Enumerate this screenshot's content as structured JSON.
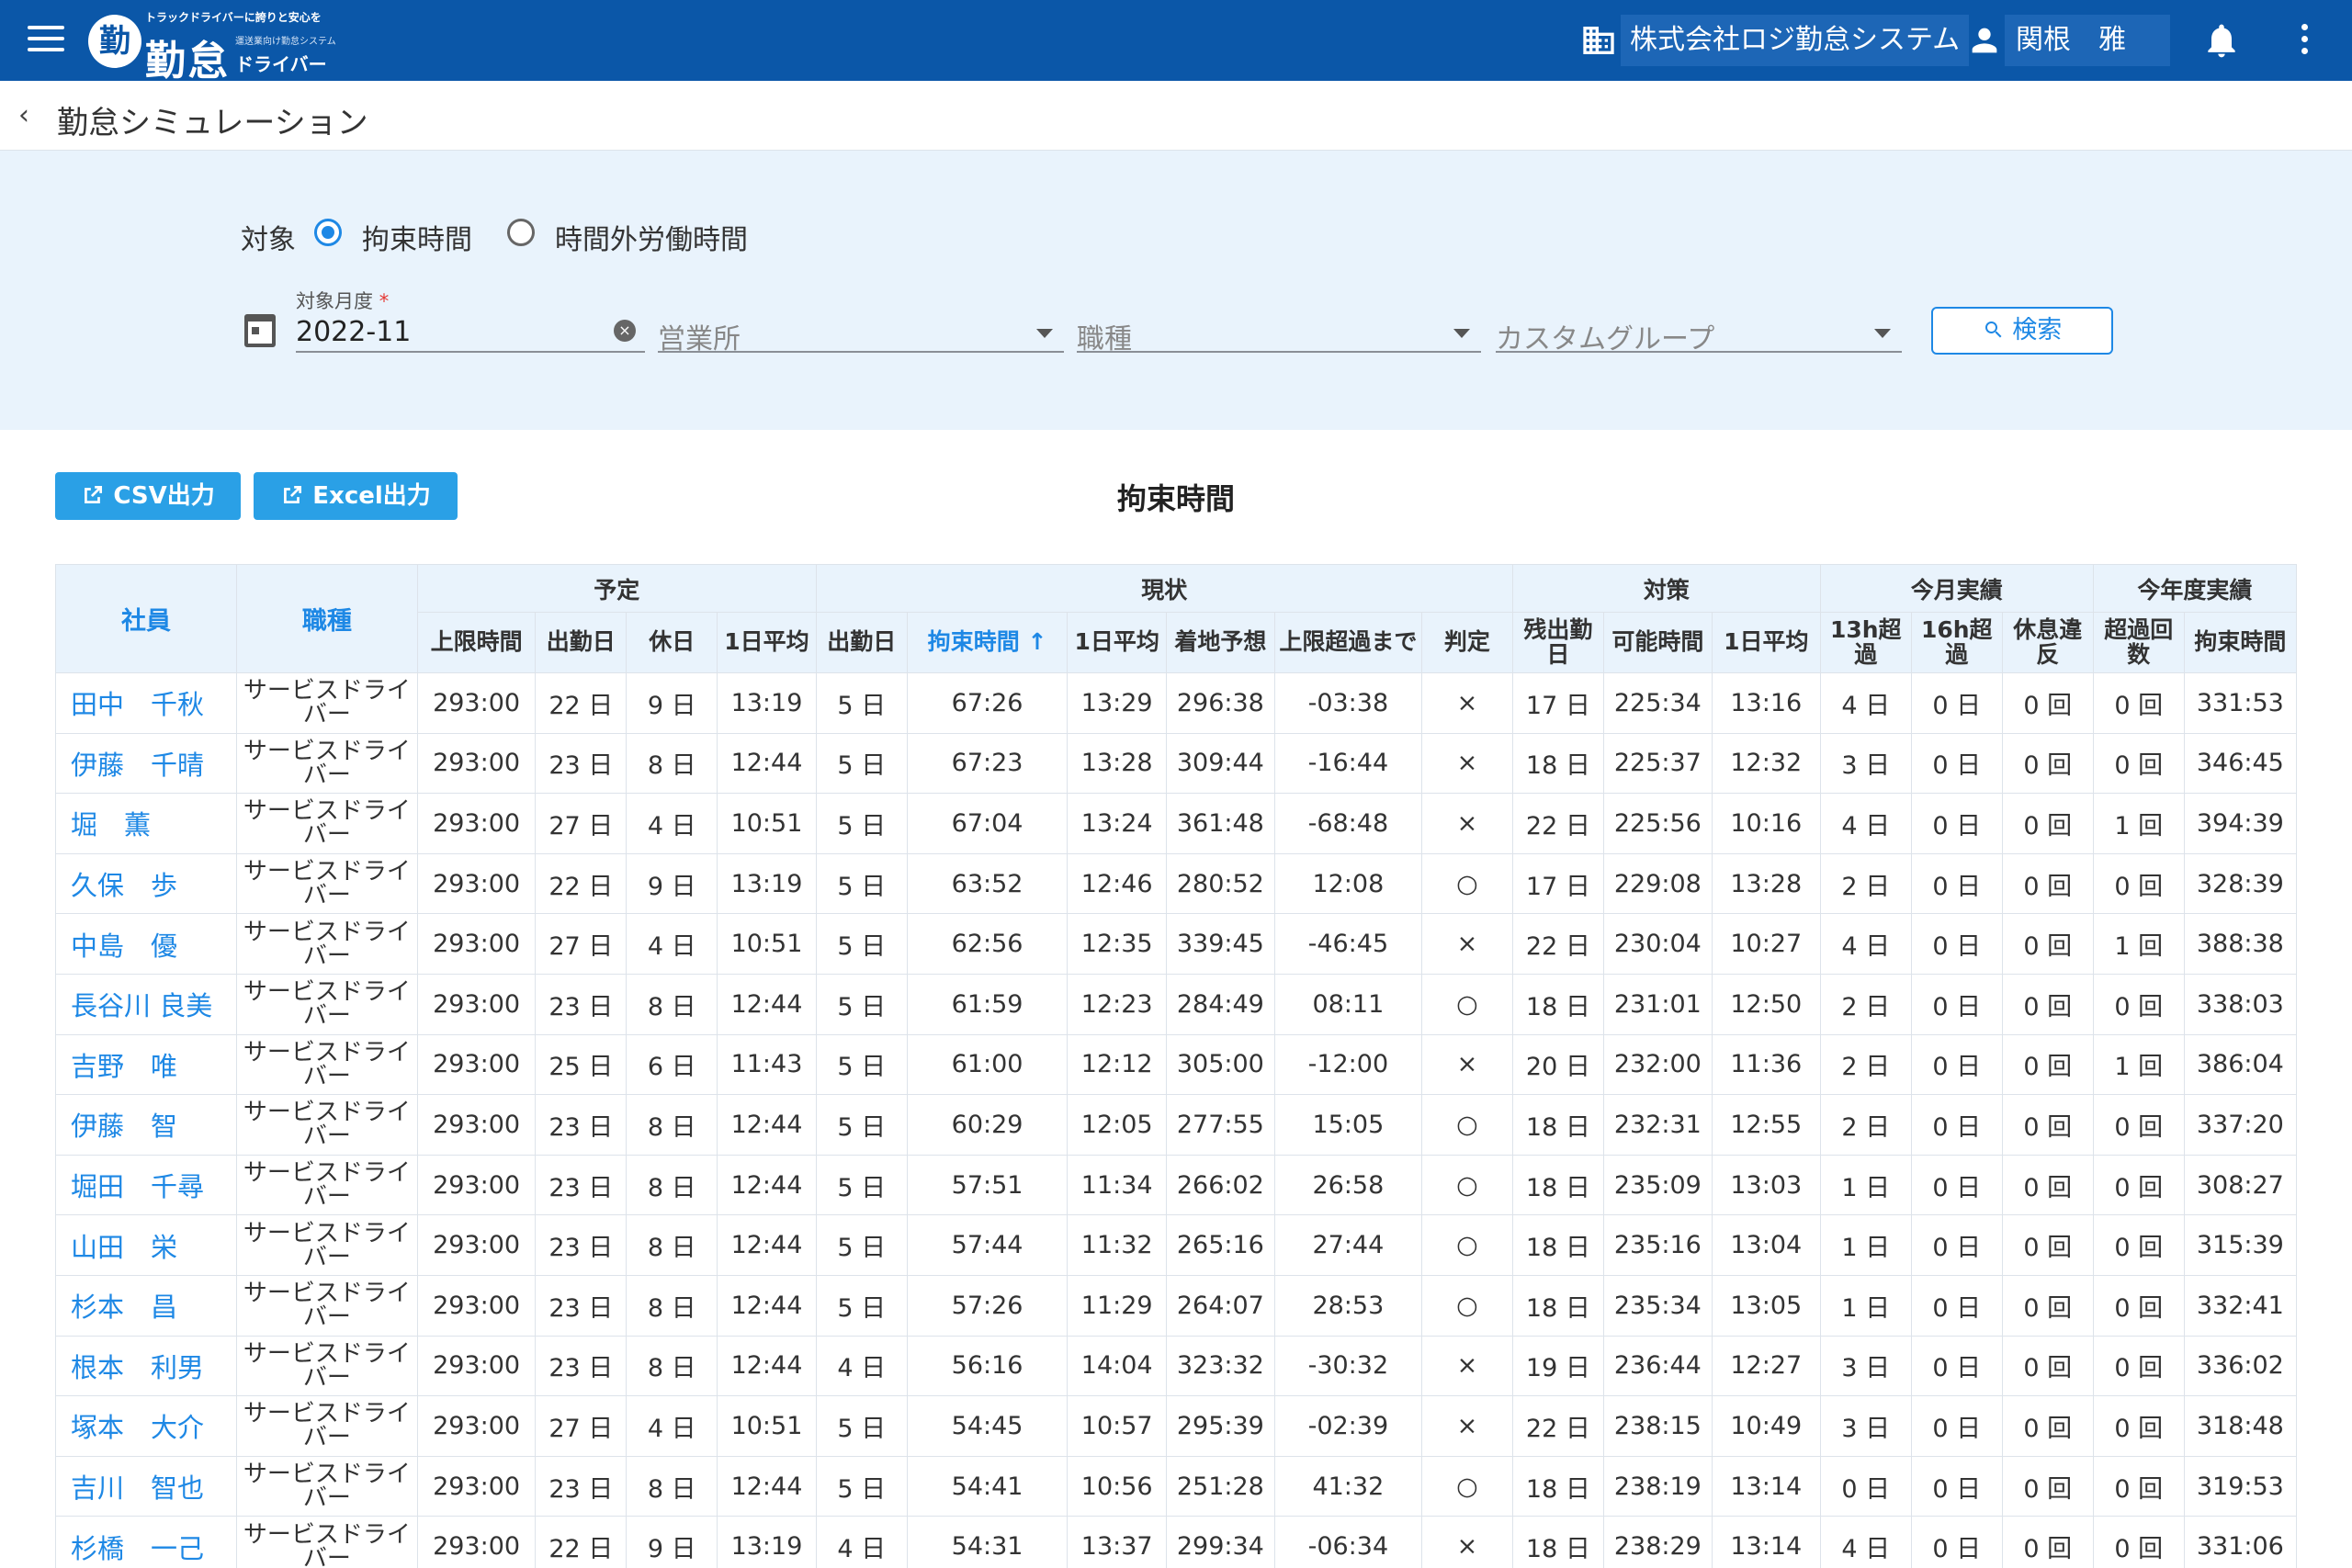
{
  "header": {
    "logo_tagline": "トラックドライバーに誇りと安心を",
    "logo_main": "勤怠",
    "logo_sub_small": "運送業向け勤怠システム",
    "logo_sub": "ドライバー",
    "company": "株式会社ロジ勤怠システム",
    "user": "関根　雅"
  },
  "page": {
    "title": "勤怠シミュレーション"
  },
  "filter": {
    "target_label": "対象",
    "radio_options": [
      "拘束時間",
      "時間外労働時間"
    ],
    "selected_radio": "拘束時間",
    "month_label": "対象月度",
    "month_required": "*",
    "month_value": "2022-11",
    "office_placeholder": "営業所",
    "job_placeholder": "職種",
    "group_placeholder": "カスタムグループ",
    "search_label": "検索"
  },
  "actions": {
    "csv_label": "CSV出力",
    "excel_label": "Excel出力"
  },
  "table": {
    "title": "拘束時間",
    "group_headers": [
      "予定",
      "現状",
      "対策",
      "今月実績",
      "今年度実績"
    ],
    "employee_header": "社員",
    "job_header": "職種",
    "sub_headers": [
      "上限時間",
      "出勤日",
      "休日",
      "1日平均",
      "出勤日",
      "拘束時間 ↑",
      "1日平均",
      "着地予想",
      "上限超過まで",
      "判定",
      "残出勤日",
      "可能時間",
      "1日平均",
      "13h超過",
      "16h超過",
      "休息違反",
      "超過回数",
      "拘束時間"
    ],
    "rows": [
      [
        "田中　千秋",
        "サービスドライバー",
        "293:00",
        "22 日",
        "9 日",
        "13:19",
        "5 日",
        "67:26",
        "13:29",
        "296:38",
        "-03:38",
        "×",
        "17 日",
        "225:34",
        "13:16",
        "4 日",
        "0 日",
        "0 回",
        "0 回",
        "331:53"
      ],
      [
        "伊藤　千晴",
        "サービスドライバー",
        "293:00",
        "23 日",
        "8 日",
        "12:44",
        "5 日",
        "67:23",
        "13:28",
        "309:44",
        "-16:44",
        "×",
        "18 日",
        "225:37",
        "12:32",
        "3 日",
        "0 日",
        "0 回",
        "0 回",
        "346:45"
      ],
      [
        "堀　薫",
        "サービスドライバー",
        "293:00",
        "27 日",
        "4 日",
        "10:51",
        "5 日",
        "67:04",
        "13:24",
        "361:48",
        "-68:48",
        "×",
        "22 日",
        "225:56",
        "10:16",
        "4 日",
        "0 日",
        "0 回",
        "1 回",
        "394:39"
      ],
      [
        "久保　歩",
        "サービスドライバー",
        "293:00",
        "22 日",
        "9 日",
        "13:19",
        "5 日",
        "63:52",
        "12:46",
        "280:52",
        "12:08",
        "○",
        "17 日",
        "229:08",
        "13:28",
        "2 日",
        "0 日",
        "0 回",
        "0 回",
        "328:39"
      ],
      [
        "中島　優",
        "サービスドライバー",
        "293:00",
        "27 日",
        "4 日",
        "10:51",
        "5 日",
        "62:56",
        "12:35",
        "339:45",
        "-46:45",
        "×",
        "22 日",
        "230:04",
        "10:27",
        "4 日",
        "0 日",
        "0 回",
        "1 回",
        "388:38"
      ],
      [
        "長谷川 良美",
        "サービスドライバー",
        "293:00",
        "23 日",
        "8 日",
        "12:44",
        "5 日",
        "61:59",
        "12:23",
        "284:49",
        "08:11",
        "○",
        "18 日",
        "231:01",
        "12:50",
        "2 日",
        "0 日",
        "0 回",
        "0 回",
        "338:03"
      ],
      [
        "吉野　唯",
        "サービスドライバー",
        "293:00",
        "25 日",
        "6 日",
        "11:43",
        "5 日",
        "61:00",
        "12:12",
        "305:00",
        "-12:00",
        "×",
        "20 日",
        "232:00",
        "11:36",
        "2 日",
        "0 日",
        "0 回",
        "1 回",
        "386:04"
      ],
      [
        "伊藤　智",
        "サービスドライバー",
        "293:00",
        "23 日",
        "8 日",
        "12:44",
        "5 日",
        "60:29",
        "12:05",
        "277:55",
        "15:05",
        "○",
        "18 日",
        "232:31",
        "12:55",
        "2 日",
        "0 日",
        "0 回",
        "0 回",
        "337:20"
      ],
      [
        "堀田　千尋",
        "サービスドライバー",
        "293:00",
        "23 日",
        "8 日",
        "12:44",
        "5 日",
        "57:51",
        "11:34",
        "266:02",
        "26:58",
        "○",
        "18 日",
        "235:09",
        "13:03",
        "1 日",
        "0 日",
        "0 回",
        "0 回",
        "308:27"
      ],
      [
        "山田　栄",
        "サービスドライバー",
        "293:00",
        "23 日",
        "8 日",
        "12:44",
        "5 日",
        "57:44",
        "11:32",
        "265:16",
        "27:44",
        "○",
        "18 日",
        "235:16",
        "13:04",
        "1 日",
        "0 日",
        "0 回",
        "0 回",
        "315:39"
      ],
      [
        "杉本　昌",
        "サービスドライバー",
        "293:00",
        "23 日",
        "8 日",
        "12:44",
        "5 日",
        "57:26",
        "11:29",
        "264:07",
        "28:53",
        "○",
        "18 日",
        "235:34",
        "13:05",
        "1 日",
        "0 日",
        "0 回",
        "0 回",
        "332:41"
      ],
      [
        "根本　利男",
        "サービスドライバー",
        "293:00",
        "23 日",
        "8 日",
        "12:44",
        "4 日",
        "56:16",
        "14:04",
        "323:32",
        "-30:32",
        "×",
        "19 日",
        "236:44",
        "12:27",
        "3 日",
        "0 日",
        "0 回",
        "0 回",
        "336:02"
      ],
      [
        "塚本　大介",
        "サービスドライバー",
        "293:00",
        "27 日",
        "4 日",
        "10:51",
        "5 日",
        "54:45",
        "10:57",
        "295:39",
        "-02:39",
        "×",
        "22 日",
        "238:15",
        "10:49",
        "3 日",
        "0 日",
        "0 回",
        "0 回",
        "318:48"
      ],
      [
        "吉川　智也",
        "サービスドライバー",
        "293:00",
        "23 日",
        "8 日",
        "12:44",
        "5 日",
        "54:41",
        "10:56",
        "251:28",
        "41:32",
        "○",
        "18 日",
        "238:19",
        "13:14",
        "0 日",
        "0 日",
        "0 回",
        "0 回",
        "319:53"
      ],
      [
        "杉橋　一己",
        "サービスドライバー",
        "293:00",
        "22 日",
        "9 日",
        "13:19",
        "4 日",
        "54:31",
        "13:37",
        "299:34",
        "-06:34",
        "×",
        "18 日",
        "238:29",
        "13:14",
        "4 日",
        "0 日",
        "0 回",
        "0 回",
        "331:06"
      ]
    ]
  }
}
